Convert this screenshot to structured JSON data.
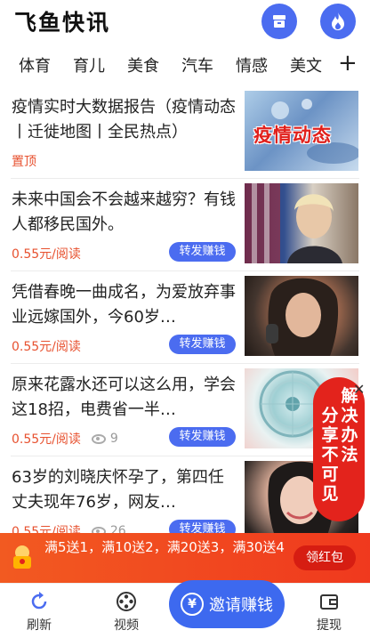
{
  "app": {
    "title": "飞鱼快讯"
  },
  "header": {
    "icons": [
      "storage-box-icon",
      "fire-icon"
    ]
  },
  "tabs": [
    "体育",
    "育儿",
    "美食",
    "汽车",
    "情感",
    "美文"
  ],
  "tabs_add": "+",
  "news": [
    {
      "title": "疫情实时大数据报告（疫情动态丨迁徙地图丨全民热点）",
      "tag": "置顶",
      "thumb_text": "疫情动态"
    },
    {
      "title": "未来中国会不会越来越穷？有钱人都移民国外。",
      "price": "0.55元/阅读",
      "share": "转发赚钱"
    },
    {
      "title": "凭借春晚一曲成名，为爱放弃事业远嫁国外，今60岁…",
      "price": "0.55元/阅读",
      "share": "转发赚钱"
    },
    {
      "title": "原来花露水还可以这么用，学会这18招，电费省一半…",
      "price": "0.55元/阅读",
      "views": "9",
      "share": "转发赚钱"
    },
    {
      "title": "63岁的刘晓庆怀孕了，第四任丈夫现年76岁，网友…",
      "price": "0.55元/阅读",
      "views": "26",
      "share": "转发赚钱"
    }
  ],
  "side_badge": {
    "col1": "分享不可见",
    "col2": "解决办法"
  },
  "promo": {
    "text": "满5送1，满10送2，满20送3，满30送4",
    "button": "领红包"
  },
  "bottom_nav": {
    "refresh": "刷新",
    "video": "视频",
    "invite": "邀请赚钱",
    "coin": "¥",
    "withdraw": "提现"
  },
  "colors": {
    "accent": "#4b6cf0",
    "price": "#e7512f",
    "promo": "#f0391e"
  }
}
